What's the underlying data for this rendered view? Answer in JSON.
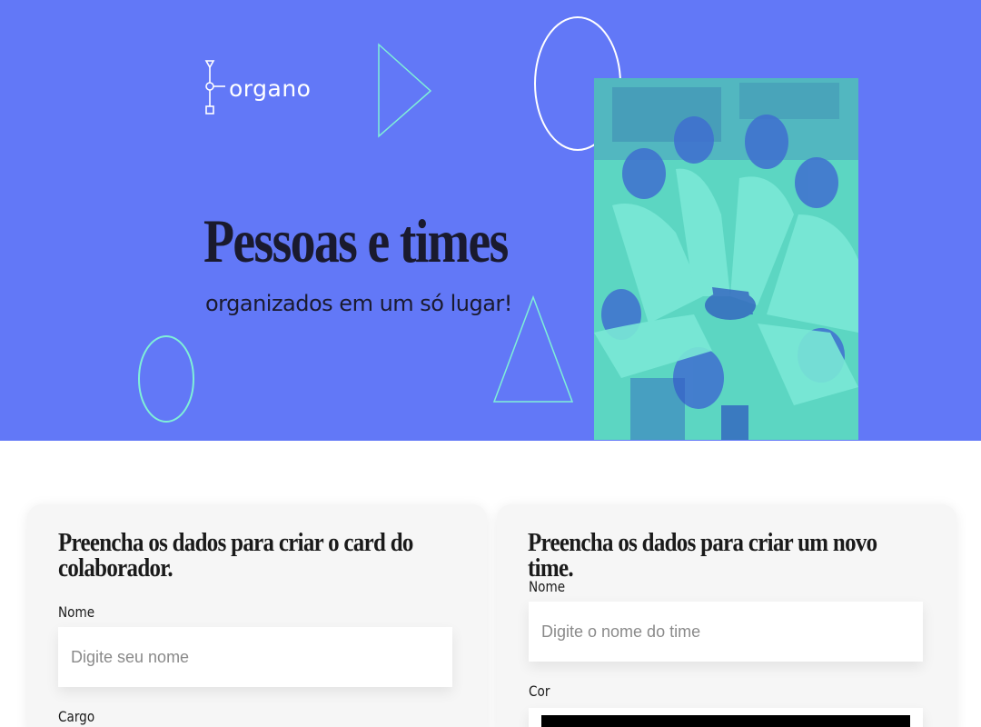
{
  "banner": {
    "logo_text": "organo",
    "headline": "Pessoas e times",
    "subline": "organizados em um só lugar!",
    "background_color": "#6278F7",
    "accent_color": "#7FF0D8",
    "photo_description_icon": "team-hands-photo"
  },
  "collaborator_form": {
    "title": "Preencha os dados para criar o card do colaborador.",
    "name_label": "Nome",
    "name_placeholder": "Digite seu nome",
    "role_label": "Cargo"
  },
  "team_form": {
    "title": "Preencha os dados para criar um novo time.",
    "name_label": "Nome",
    "name_placeholder": "Digite o nome do time",
    "color_label": "Cor",
    "color_value": "#000000"
  }
}
